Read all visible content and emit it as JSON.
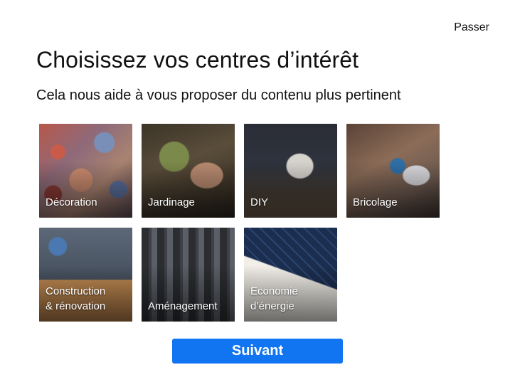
{
  "header": {
    "skip_label": "Passer",
    "title": "Choisissez vos centres d’intérêt",
    "subtitle": "Cela nous aide à vous proposer du contenu plus pertinent"
  },
  "interests": [
    {
      "label": "Décoration"
    },
    {
      "label": "Jardinage"
    },
    {
      "label": "DIY"
    },
    {
      "label": "Bricolage"
    },
    {
      "label": "Construction\n& rénovation"
    },
    {
      "label": "Aménagement"
    },
    {
      "label": "Economie\nd’énergie"
    }
  ],
  "footer": {
    "next_label": "Suivant"
  },
  "colors": {
    "accent": "#1174f0",
    "text": "#111111",
    "background": "#ffffff"
  }
}
